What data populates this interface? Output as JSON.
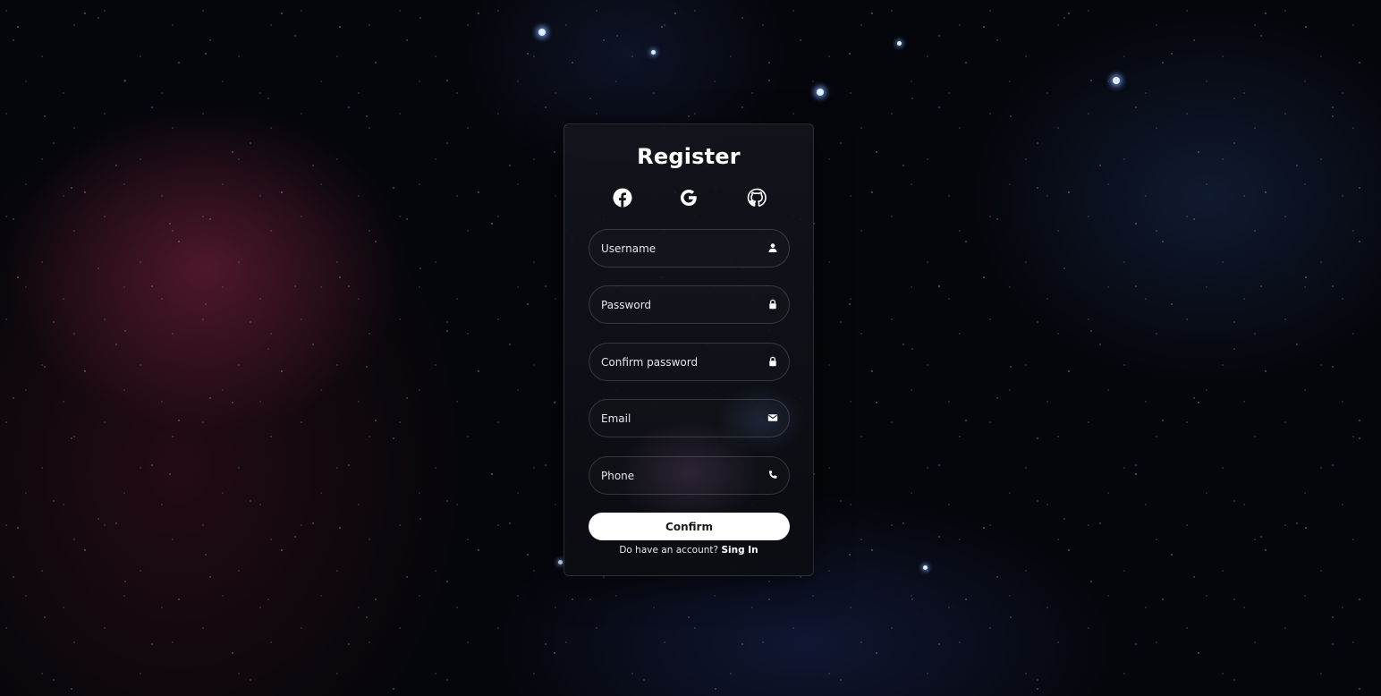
{
  "colors": {
    "background": "#05060b",
    "card_background": "#14161e",
    "text": "#ffffff",
    "button_background": "#ffffff",
    "button_text": "#1a1a1f"
  },
  "register": {
    "title": "Register",
    "socials": [
      {
        "icon": "facebook-icon"
      },
      {
        "icon": "google-icon"
      },
      {
        "icon": "github-icon"
      }
    ],
    "fields": {
      "username": {
        "placeholder": "Username",
        "value": "",
        "icon": "user-icon"
      },
      "password": {
        "placeholder": "Password",
        "value": "",
        "icon": "lock-icon"
      },
      "confirm_password": {
        "placeholder": "Confirm password",
        "value": "",
        "icon": "lock-icon"
      },
      "email": {
        "placeholder": "Email",
        "value": "",
        "icon": "envelope-icon"
      },
      "phone": {
        "placeholder": "Phone",
        "value": "",
        "icon": "phone-icon"
      }
    },
    "confirm_label": "Confirm",
    "footer_text": "Do have an account?",
    "signin_label": "Sing In"
  }
}
